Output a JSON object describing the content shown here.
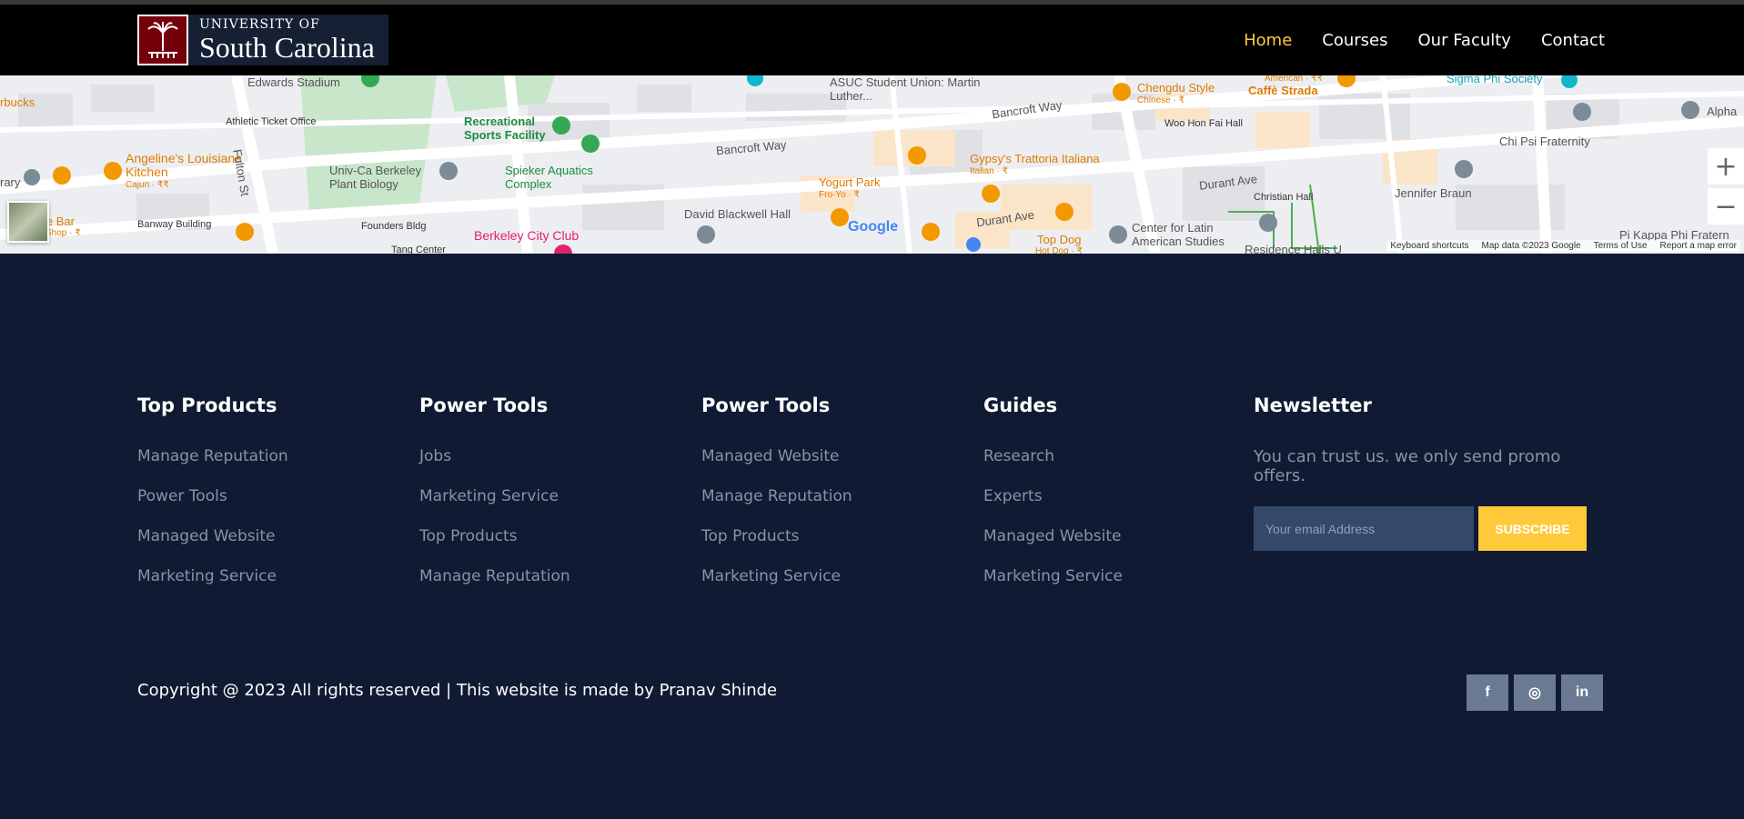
{
  "header": {
    "logo_top": "UNIVERSITY OF",
    "logo_main": "South Carolina",
    "nav": [
      {
        "label": "Home",
        "active": true
      },
      {
        "label": "Courses"
      },
      {
        "label": "Our Faculty"
      },
      {
        "label": "Contact"
      }
    ]
  },
  "map": {
    "labels": {
      "edwards_stadium": "Edwards Stadium",
      "athletic_ticket_office": "Athletic Ticket Office",
      "recreational_sports": "Recreational Sports Facility",
      "spieker": "Spieker Aquatics Complex",
      "univ_ca": "Univ-Ca Berkeley Plant Biology",
      "founders": "Founders Bldg",
      "berkeley_city_club": "Berkeley City Club",
      "banway": "Banway Building",
      "tang_center": "Tang Center",
      "angelines": "Angeline's Louisiana Kitchen",
      "angelines_sub": "Cajun · ₹₹",
      "fulton": "Fulton St",
      "bancroft_way_1": "Bancroft Way",
      "bancroft_way_2": "Bancroft Way",
      "asuc": "ASUC Student Union: Martin Luther...",
      "david_blackwell": "David Blackwell Hall",
      "yogurt_park": "Yogurt Park",
      "yogurt_sub": "Fro-Yo · ₹",
      "gypsys": "Gypsy's Trattoria Italiana",
      "gypsys_sub": "Italian · ₹",
      "chengdu": "Chengdu Style",
      "chengdu_sub": "Chinese · ₹",
      "caffe_strada": "Caffè Strada",
      "woo_hon_fai": "Woo Hon Fai Hall",
      "durant_ave_1": "Durant Ave",
      "durant_ave_2": "Durant Ave",
      "top_dog": "Top Dog",
      "top_dog_sub": "Hot Dog · ₹",
      "center_latin": "Center for Latin American Studies",
      "christian_hall": "Christian Hall",
      "chi_psi": "Chi Psi Fraternity",
      "jennifer_braun": "Jennifer Braun",
      "sigma_phi": "Sigma Phi Society",
      "alpha": "Alpha",
      "pi_kappa": "Pi Kappa Phi Fratern",
      "residence_halls": "Residence Halls U",
      "bucks": "rbucks",
      "library": "rary",
      "le_bar": "le Bar",
      "le_bar_sub": "Shop · ₹",
      "american": "American · ₹₹"
    },
    "google": "Google",
    "zoom_in": "+",
    "zoom_out": "−",
    "footer": {
      "shortcuts": "Keyboard shortcuts",
      "map_data": "Map data ©2023 Google",
      "terms": "Terms of Use",
      "report": "Report a map error"
    }
  },
  "footer": {
    "columns": [
      {
        "title": "Top Products",
        "links": [
          "Manage Reputation",
          "Power Tools",
          "Managed Website",
          "Marketing Service"
        ]
      },
      {
        "title": "Power Tools",
        "links": [
          "Jobs",
          "Marketing Service",
          "Top Products",
          "Manage Reputation"
        ]
      },
      {
        "title": "Power Tools",
        "links": [
          "Managed Website",
          "Manage Reputation",
          "Top Products",
          "Marketing Service"
        ]
      },
      {
        "title": "Guides",
        "links": [
          "Research",
          "Experts",
          "Managed Website",
          "Marketing Service"
        ]
      }
    ],
    "newsletter": {
      "title": "Newsletter",
      "text": "You can trust us. we only send promo offers.",
      "placeholder": "Your email Address",
      "button": "SUBSCRIBE"
    },
    "copyright": "Copyright @ 2023 All rights reserved | This website is made by Pranav Shinde",
    "social": [
      {
        "name": "facebook",
        "glyph": "f"
      },
      {
        "name": "instagram",
        "glyph": "◎"
      },
      {
        "name": "linkedin",
        "glyph": "in"
      }
    ]
  }
}
